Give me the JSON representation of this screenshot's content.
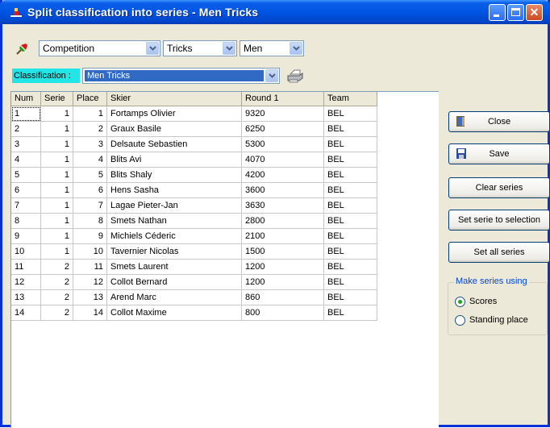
{
  "window": {
    "title": "Split classification into series - Men Tricks",
    "icons": {
      "app": "ski-icon",
      "minimize": "minimize-icon",
      "maximize": "maximize-icon",
      "close": "close-icon"
    }
  },
  "toolbar": {
    "icon": "pin-icon",
    "competition": "Competition",
    "event": "Tricks",
    "category": "Men"
  },
  "classification": {
    "label": "Classification :",
    "value": "Men Tricks",
    "print_icon": "printer-icon"
  },
  "table": {
    "columns": [
      "Num",
      "Serie",
      "Place",
      "Skier",
      "Round 1",
      "Team"
    ],
    "rows": [
      [
        "1",
        "1",
        "1",
        "Fortamps Olivier",
        "9320",
        "BEL"
      ],
      [
        "2",
        "1",
        "2",
        "Graux Basile",
        "6250",
        "BEL"
      ],
      [
        "3",
        "1",
        "3",
        "Delsaute Sebastien",
        "5300",
        "BEL"
      ],
      [
        "4",
        "1",
        "4",
        "Blits Avi",
        "4070",
        "BEL"
      ],
      [
        "5",
        "1",
        "5",
        "Blits Shaly",
        "4200",
        "BEL"
      ],
      [
        "6",
        "1",
        "6",
        "Hens Sasha",
        "3600",
        "BEL"
      ],
      [
        "7",
        "1",
        "7",
        "Lagae Pieter-Jan",
        "3630",
        "BEL"
      ],
      [
        "8",
        "1",
        "8",
        "Smets Nathan",
        "2800",
        "BEL"
      ],
      [
        "9",
        "1",
        "9",
        "Michiels Céderic",
        "2100",
        "BEL"
      ],
      [
        "10",
        "1",
        "10",
        "Tavernier Nicolas",
        "1500",
        "BEL"
      ],
      [
        "11",
        "2",
        "11",
        "Smets Laurent",
        "1200",
        "BEL"
      ],
      [
        "12",
        "2",
        "12",
        "Collot Bernard",
        "1200",
        "BEL"
      ],
      [
        "13",
        "2",
        "13",
        "Arend Marc",
        "860",
        "BEL"
      ],
      [
        "14",
        "2",
        "14",
        "Collot Maxime",
        "800",
        "BEL"
      ]
    ]
  },
  "buttons": {
    "close": "Close",
    "save": "Save",
    "clear_series": "Clear series",
    "set_serie_to_selection": "Set serie to selection",
    "set_all_series": "Set all series"
  },
  "make_series": {
    "title": "Make series using",
    "options": [
      "Scores",
      "Standing place"
    ],
    "selected": "Scores"
  }
}
